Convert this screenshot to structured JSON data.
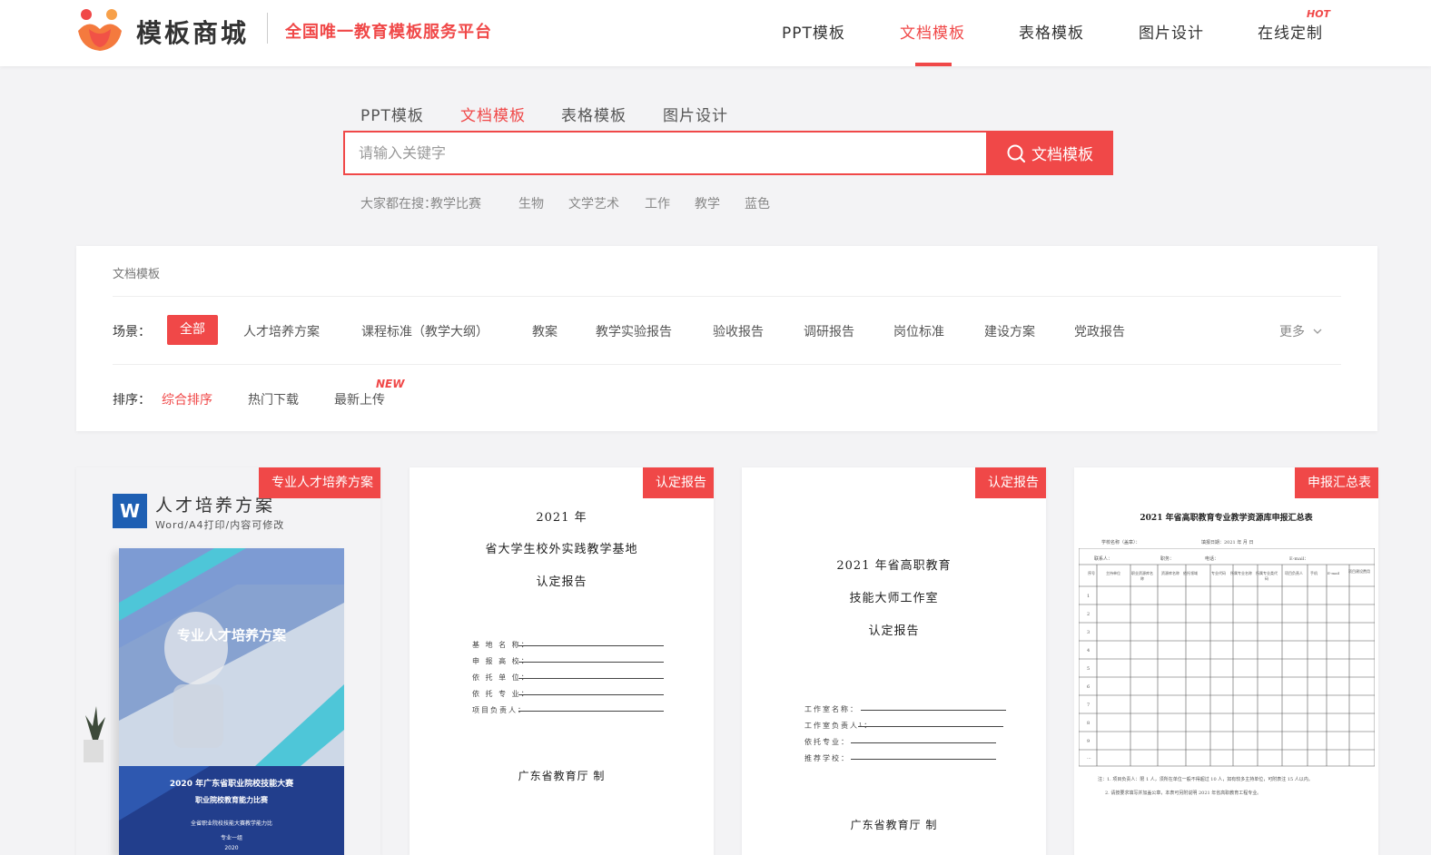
{
  "header": {
    "logo_text": "模板商城",
    "slogan": "全国唯一教育模板服务平台",
    "nav": [
      {
        "label": "PPT模板",
        "active": false
      },
      {
        "label": "文档模板",
        "active": true
      },
      {
        "label": "表格模板",
        "active": false
      },
      {
        "label": "图片设计",
        "active": false
      },
      {
        "label": "在线定制",
        "active": false
      }
    ],
    "hot_badge": "HOT"
  },
  "search": {
    "tabs": [
      {
        "label": "PPT模板",
        "active": false
      },
      {
        "label": "文档模板",
        "active": true
      },
      {
        "label": "表格模板",
        "active": false
      },
      {
        "label": "图片设计",
        "active": false
      }
    ],
    "placeholder": "请输入关键字",
    "value": "",
    "button_label": "文档模板",
    "hot_prefix": "大家都在搜：",
    "hot_terms": [
      "教学比赛",
      "生物",
      "文学艺术",
      "工作",
      "教学",
      "蓝色"
    ]
  },
  "filter": {
    "title": "文档模板",
    "scene_label": "场景：",
    "scenes": [
      {
        "label": "全部",
        "active": true
      },
      {
        "label": "人才培养方案",
        "active": false
      },
      {
        "label": "课程标准（教学大纲）",
        "active": false
      },
      {
        "label": "教案",
        "active": false
      },
      {
        "label": "教学实验报告",
        "active": false
      },
      {
        "label": "验收报告",
        "active": false
      },
      {
        "label": "调研报告",
        "active": false
      },
      {
        "label": "岗位标准",
        "active": false
      },
      {
        "label": "建设方案",
        "active": false
      },
      {
        "label": "党政报告",
        "active": false
      }
    ],
    "more_label": "更多",
    "sort_label": "排序：",
    "sorts": [
      {
        "label": "综合排序",
        "active": true
      },
      {
        "label": "热门下载",
        "active": false
      },
      {
        "label": "最新上传",
        "active": false
      }
    ],
    "new_badge": "NEW"
  },
  "cards": [
    {
      "tag": "专业人才培养方案",
      "word_icon": "W",
      "title": "人才培养方案",
      "subtitle": "Word/A4打印/内容可修改",
      "cover_title": "专业人才培养方案",
      "cover_line1": "2020 年广东省职业院校技能大赛",
      "cover_line2": "职业院校教育能力比赛",
      "cover_line3": "全省职业院校技能大赛教学能力比",
      "cover_line4": "专业一组",
      "cover_line5": "2020"
    },
    {
      "tag": "认定报告",
      "lines": [
        "2021 年",
        "省大学生校外实践教学基地",
        "认定报告"
      ],
      "fields": [
        "基 地 名 称：",
        "申 报 高 校：",
        "依 托 单 位：",
        "依 托 专 业：",
        "项目负责人："
      ],
      "footer": "广东省教育厅  制"
    },
    {
      "tag": "认定报告",
      "lines": [
        "2021 年省高职教育",
        "技能大师工作室",
        "认定报告"
      ],
      "fields": [
        "工作室名称：",
        "工作室负责人¹：",
        "依托专业：",
        "推荐学校："
      ],
      "footer": "广东省教育厅  制"
    },
    {
      "tag": "申报汇总表",
      "table_title": "2021 年省高职教育专业教学资源库申报汇总表",
      "meta_left": "学校名称（盖章）：",
      "meta_right": "填报日期：2021 年    月    日",
      "contact": [
        "联系人：",
        "职务：",
        "电话：",
        "E-mail："
      ],
      "headers": [
        "序号",
        "主持单位",
        "职业资源库名称",
        "资源库名称",
        "依托领域",
        "专业代码",
        "所属专业名称",
        "所属专业类代码",
        "项目负责人",
        "手机",
        "E-mail",
        "项目建设费用"
      ],
      "row_numbers": [
        "1",
        "2",
        "3",
        "4",
        "5",
        "6",
        "7",
        "8",
        "9",
        "..."
      ],
      "note1": "注：1. 项目负责人：限 1 人，须所在单位一般不得超过 10 人，如有较多主持单位，可附表注 15 人以内。",
      "note2": "2. 请按要求填写并加盖公章，本表可另附说明 2021 年省高职教育工程专业。"
    }
  ]
}
